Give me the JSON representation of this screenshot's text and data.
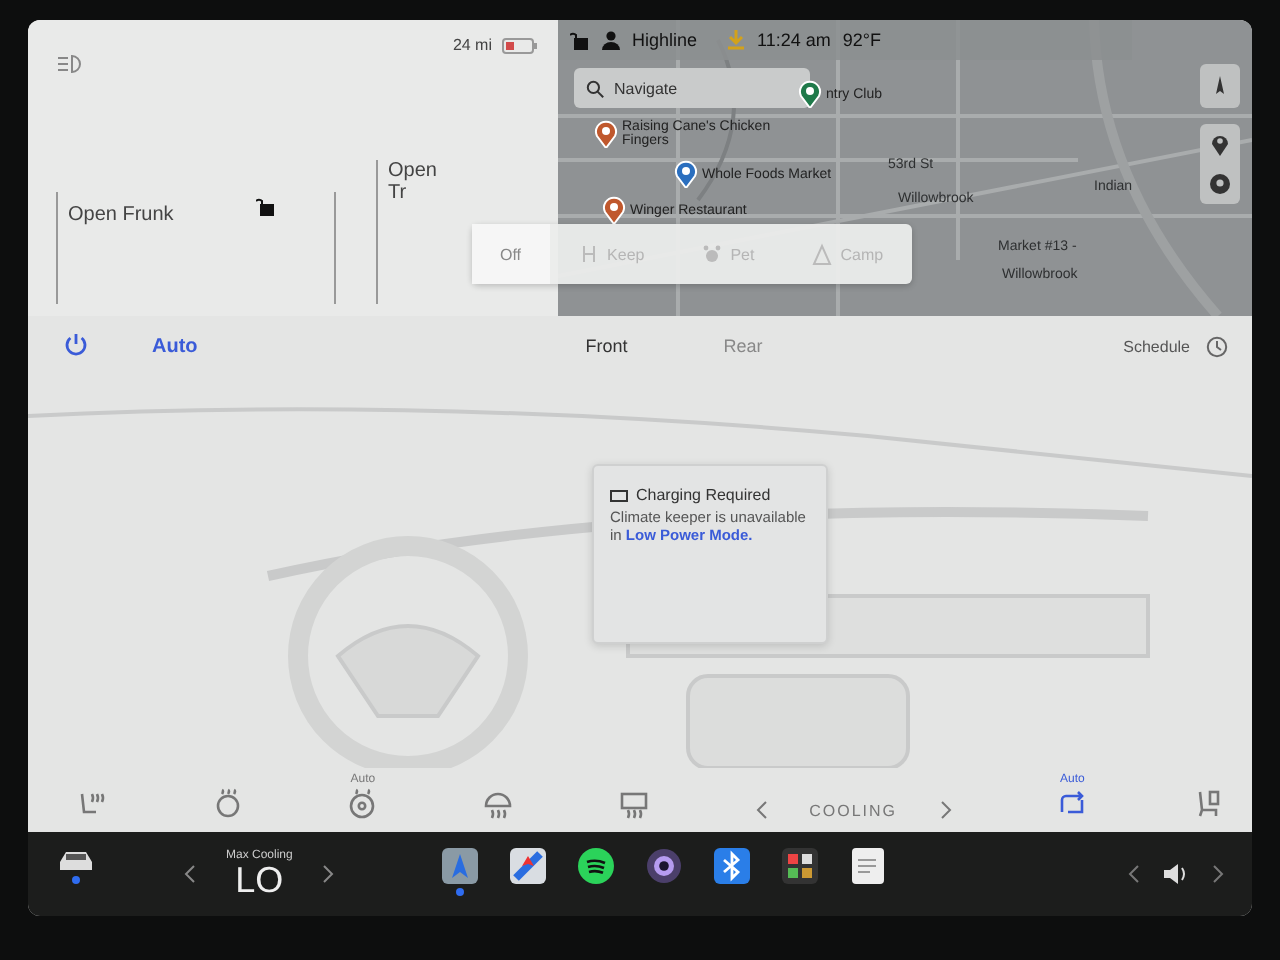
{
  "status": {
    "range": "24 mi",
    "profile": "Highline",
    "time": "11:24 am",
    "temperature": "92°F",
    "locked": false
  },
  "vehicle": {
    "frunk": "Open Frunk",
    "trunk": "Open Tr",
    "locked": false
  },
  "map": {
    "search": {
      "placeholder": "Navigate"
    },
    "places": [
      {
        "kind": "golf",
        "label": "ntry Club"
      },
      {
        "kind": "restaurant",
        "label": "Raising Cane's Chicken Fingers"
      },
      {
        "kind": "grocery",
        "label": "Whole Foods Market"
      },
      {
        "kind": "restaurant",
        "label": "Winger Restaurant"
      }
    ],
    "labels": [
      "53rd St",
      "Willowbrook",
      "Market #13 -",
      "Willowbrook",
      "Indian"
    ]
  },
  "climate_keeper": [
    {
      "label": "Off",
      "kind": "off",
      "selected": true
    },
    {
      "label": "Keep",
      "kind": "keep",
      "selected": false
    },
    {
      "label": "Pet",
      "kind": "pet",
      "selected": false
    },
    {
      "label": "Camp",
      "kind": "camp",
      "selected": false
    }
  ],
  "climate": {
    "power_on": true,
    "mode": "Auto",
    "zones": [
      {
        "label": "Front",
        "selected": true
      },
      {
        "label": "Rear",
        "selected": false
      }
    ],
    "schedule": "Schedule",
    "notification": {
      "title": "Charging Required",
      "text": "Climate keeper is unavailable in ",
      "link": "Low Power Mode."
    },
    "controls": [
      {
        "kind": "seat_heat",
        "active": false
      },
      {
        "kind": "wheel_heat",
        "active": false
      },
      {
        "kind": "steering_heat",
        "label": "Auto",
        "active": false
      },
      {
        "kind": "defrost_front",
        "active": false
      },
      {
        "kind": "defrost_rear",
        "active": false
      },
      {
        "kind": "fan",
        "label": "COOLING",
        "active": false
      },
      {
        "kind": "recirculate",
        "label": "Auto",
        "active": true
      },
      {
        "kind": "seat",
        "active": false
      }
    ]
  },
  "taskbar": {
    "car_running": true,
    "temp_label": "Max Cooling",
    "temp": "LO",
    "apps": [
      {
        "kind": "navigation",
        "running": true
      },
      {
        "kind": "maps",
        "running": false
      },
      {
        "kind": "spotify",
        "running": false
      },
      {
        "kind": "camera",
        "running": false
      },
      {
        "kind": "bluetooth",
        "running": false
      },
      {
        "kind": "apps",
        "running": false
      },
      {
        "kind": "notes",
        "running": false
      }
    ]
  }
}
